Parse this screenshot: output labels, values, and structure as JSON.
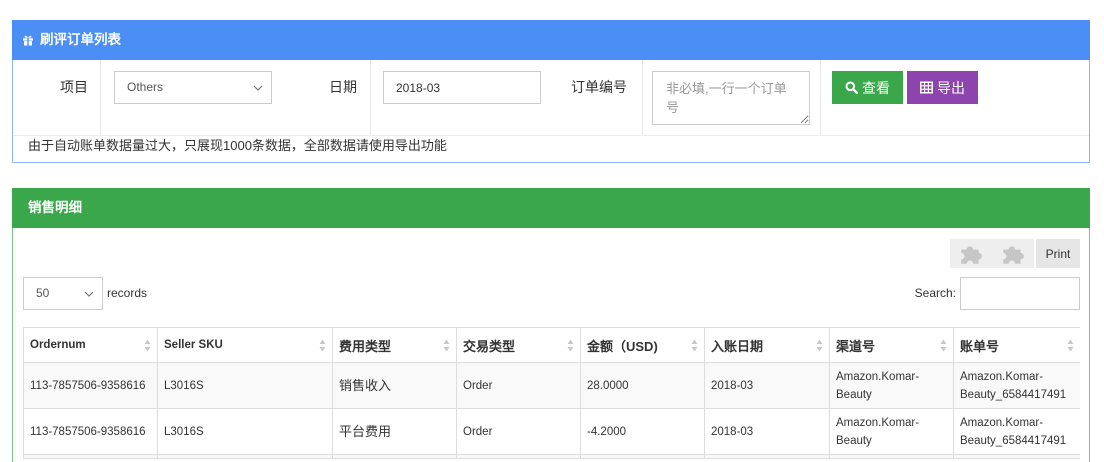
{
  "theme": {
    "header_blue": "#4a8ef6",
    "header_green": "#3aa84a",
    "search_button": "#3aa84a",
    "export_button": "#8e44ad"
  },
  "order_panel": {
    "icon": "gift-icon",
    "title": "刷评订单列表",
    "filters": {
      "project": {
        "label": "项目",
        "value": "Others",
        "icon": "chevron-down-icon"
      },
      "date": {
        "label": "日期",
        "value": "2018-03"
      },
      "order_no": {
        "label": "订单编号",
        "placeholder": "非必填,一行一个订单号"
      }
    },
    "buttons": {
      "search": {
        "label": "查看",
        "icon": "search-icon"
      },
      "export": {
        "label": "导出",
        "icon": "table-icon"
      }
    },
    "notice": "由于自动账单数据量过大，只展现1000条数据，全部数据请使用导出功能"
  },
  "sales_panel": {
    "title": "销售明细",
    "toolbar": {
      "icon_buttons": [
        "puzzle-icon",
        "puzzle-icon"
      ],
      "print_label": "Print"
    },
    "page_length": {
      "value": "50",
      "suffix": "records",
      "icon": "chevron-down-icon"
    },
    "search": {
      "label": "Search:"
    },
    "table": {
      "sort_icon": "sort-icon",
      "columns": [
        "Ordernum",
        "Seller SKU",
        "费用类型",
        "交易类型",
        "金额（USD)",
        "入账日期",
        "渠道号",
        "账单号"
      ],
      "rows": [
        [
          "113-7857506-9358616",
          "L3016S",
          "销售收入",
          "Order",
          "28.0000",
          "2018-03",
          "Amazon.Komar-Beauty",
          "Amazon.Komar-Beauty_6584417491"
        ],
        [
          "113-7857506-9358616",
          "L3016S",
          "平台费用",
          "Order",
          "-4.2000",
          "2018-03",
          "Amazon.Komar-Beauty",
          "Amazon.Komar-Beauty_6584417491"
        ]
      ]
    }
  }
}
